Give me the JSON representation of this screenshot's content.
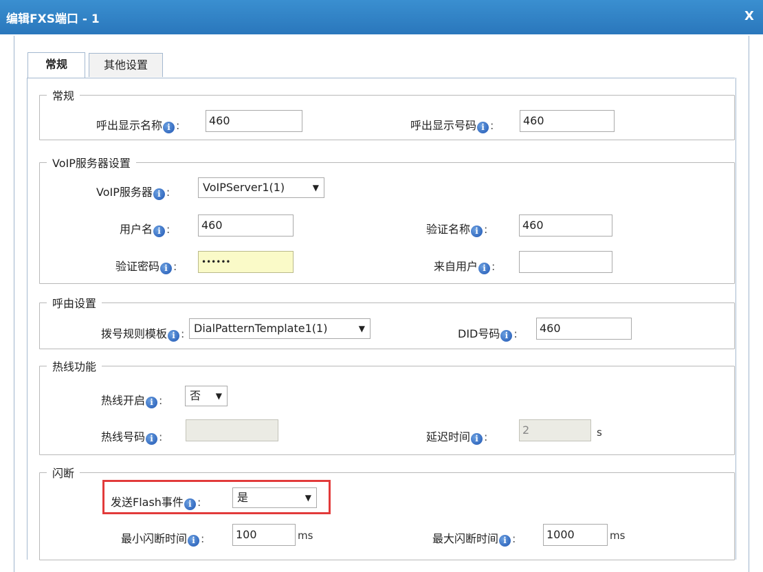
{
  "window": {
    "title": "编辑FXS端口 - 1",
    "close_label": "X"
  },
  "tabs": [
    {
      "label": "常规",
      "active": true
    },
    {
      "label": "其他设置",
      "active": false
    }
  ],
  "groups": {
    "general": {
      "legend": "常规",
      "caller_id_name": {
        "label": "呼出显示名称",
        "value": "460"
      },
      "caller_id_number": {
        "label": "呼出显示号码",
        "value": "460"
      }
    },
    "voip": {
      "legend": "VoIP服务器设置",
      "server": {
        "label": "VoIP服务器",
        "value": "VoIPServer1(1)"
      },
      "username": {
        "label": "用户名",
        "value": "460"
      },
      "auth_name": {
        "label": "验证名称",
        "value": "460"
      },
      "auth_password": {
        "label": "验证密码",
        "value": "••••••"
      },
      "from_user": {
        "label": "来自用户",
        "value": ""
      }
    },
    "routing": {
      "legend": "呼由设置",
      "dial_pattern": {
        "label": "拨号规则模板",
        "value": "DialPatternTemplate1(1)"
      },
      "did": {
        "label": "DID号码",
        "value": "460"
      }
    },
    "hotline": {
      "legend": "热线功能",
      "enable": {
        "label": "热线开启",
        "value": "否"
      },
      "number": {
        "label": "热线号码",
        "value": ""
      },
      "delay": {
        "label": "延迟时间",
        "value": "2",
        "unit": "s"
      }
    },
    "flash": {
      "legend": "闪断",
      "send_flash": {
        "label": "发送Flash事件",
        "value": "是"
      },
      "min_time": {
        "label": "最小闪断时间",
        "value": "100",
        "unit": "ms"
      },
      "max_time": {
        "label": "最大闪断时间",
        "value": "1000",
        "unit": "ms"
      }
    }
  },
  "colors": {
    "titlebar": "#2a77bc",
    "highlight": "#e23a3a",
    "info_icon": "#1f56b3"
  }
}
